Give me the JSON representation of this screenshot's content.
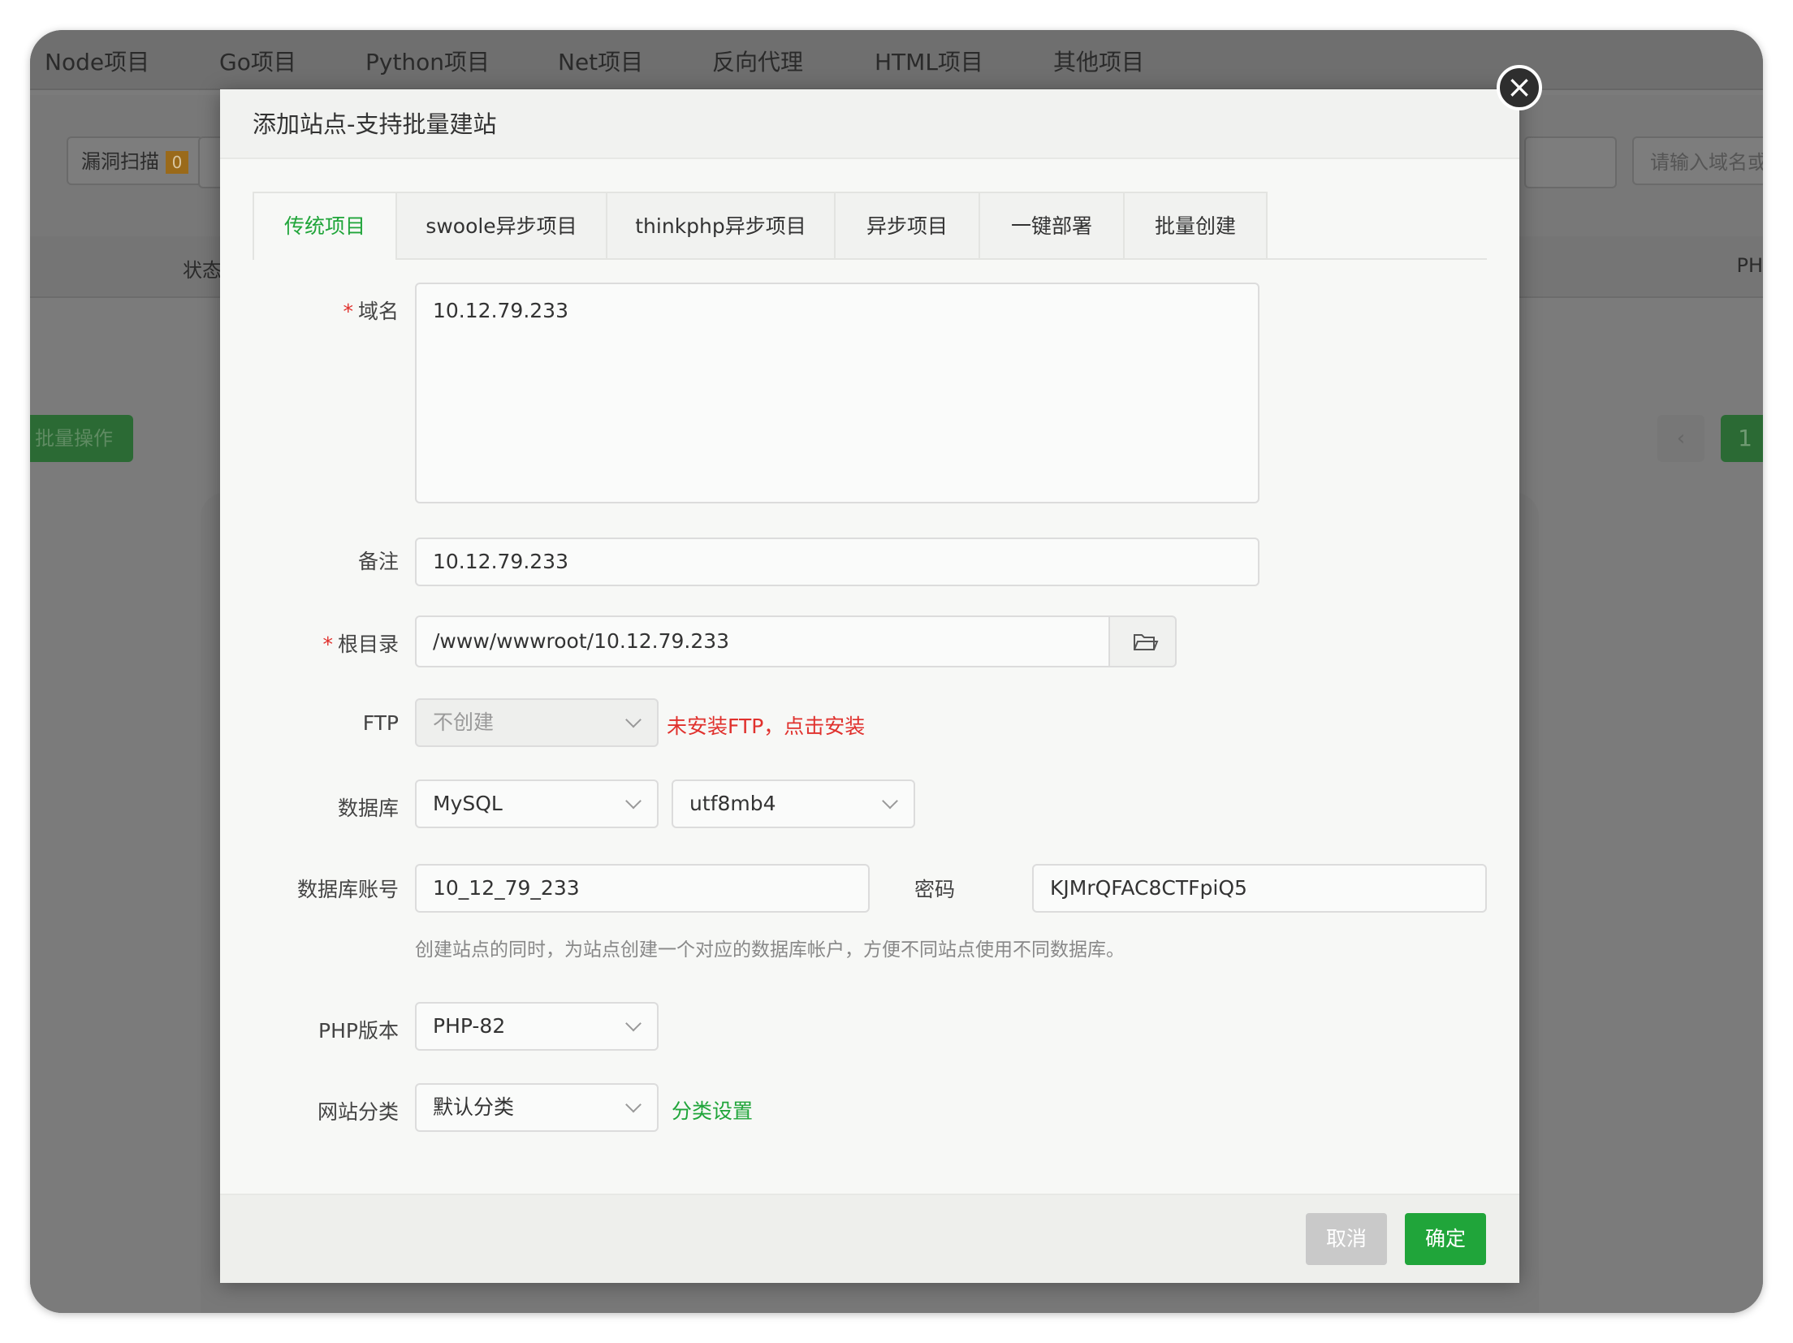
{
  "top_nav": [
    "Node项目",
    "Go项目",
    "Python项目",
    "Net项目",
    "反向代理",
    "HTML项目",
    "其他项目"
  ],
  "background": {
    "vuln_scan_label": "漏洞扫描",
    "vuln_count": "0",
    "search_placeholder": "请输入域名或",
    "status_col": "状态",
    "php_col": "PH",
    "batch_button": "批量操作",
    "prev_page": "‹",
    "current_page": "1"
  },
  "modal": {
    "title": "添加站点-支持批量建站",
    "close_icon": "close-icon",
    "tabs": [
      "传统项目",
      "swoole异步项目",
      "thinkphp异步项目",
      "异步项目",
      "一键部署",
      "批量创建"
    ],
    "active_tab": "传统项目",
    "form": {
      "domain_label": "域名",
      "domain_value": "10.12.79.233",
      "remark_label": "备注",
      "remark_value": "10.12.79.233",
      "root_label": "根目录",
      "root_value": "/www/wwwroot/10.12.79.233",
      "ftp_label": "FTP",
      "ftp_value": "不创建",
      "ftp_warning": "未安装FTP，点击安装",
      "db_label": "数据库",
      "db_type": "MySQL",
      "db_charset": "utf8mb4",
      "db_account_label": "数据库账号",
      "db_account_value": "10_12_79_233",
      "password_label": "密码",
      "password_value": "KJMrQFAC8CTFpiQ5",
      "db_hint": "创建站点的同时，为站点创建一个对应的数据库帐户，方便不同站点使用不同数据库。",
      "php_label": "PHP版本",
      "php_value": "PHP-82",
      "category_label": "网站分类",
      "category_value": "默认分类",
      "category_link": "分类设置"
    },
    "buttons": {
      "cancel": "取消",
      "ok": "确定"
    }
  },
  "colors": {
    "accent": "#20a53a",
    "danger": "#e0312d"
  }
}
